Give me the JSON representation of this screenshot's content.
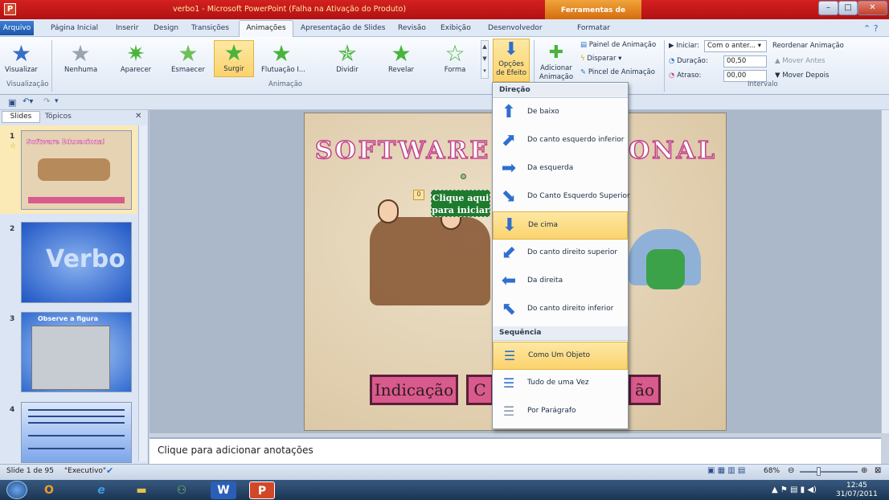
{
  "window": {
    "title": "verbo1 - Microsoft PowerPoint (Falha na Ativação do Produto)",
    "contextual_tools": "Ferramentas de Desenho"
  },
  "tabs": [
    "Arquivo",
    "Página Inicial",
    "Inserir",
    "Design",
    "Transições",
    "Animações",
    "Apresentação de Slides",
    "Revisão",
    "Exibição",
    "Desenvolvedor",
    "Formatar"
  ],
  "ribbon": {
    "preview_label": "Visualizar",
    "group_preview": "Visualização",
    "group_animation": "Animação",
    "group_timing": "Intervalo",
    "animations": [
      "Nenhuma",
      "Aparecer",
      "Esmaecer",
      "Surgir",
      "Flutuação I...",
      "Dividir",
      "Revelar",
      "Forma"
    ],
    "selected_animation": "Surgir",
    "effect_options": "Opções de Efeito",
    "effect_options_l1": "Opções",
    "effect_options_l2": "de Efeito",
    "add_animation_l1": "Adicionar",
    "add_animation_l2": "Animação",
    "animation_pane": "Painel de Animação",
    "trigger": "Disparar",
    "animation_painter": "Pincel de Animação",
    "start_label": "Iniciar:",
    "start_value": "Com o anter...",
    "duration_label": "Duração:",
    "duration_value": "00,50",
    "delay_label": "Atraso:",
    "delay_value": "00,00",
    "reorder": "Reordenar Animação",
    "move_earlier": "Mover Antes",
    "move_later": "Mover Depois"
  },
  "panel": {
    "tab_slides": "Slides",
    "tab_outline": "Tópicos"
  },
  "thumbnails": [
    {
      "num": "1",
      "title": "Software Educacional"
    },
    {
      "num": "2",
      "title": "Verbo"
    },
    {
      "num": "3",
      "title": "Observe a figura"
    },
    {
      "num": "4",
      "title": ""
    }
  ],
  "slide": {
    "title": "SOFTWARE EDUCACIONAL",
    "title_visible_left": "SOFTWARE",
    "title_visible_right": "ONAL",
    "button_text_l1": "Clique aqui",
    "button_text_l2": "para iniciar",
    "anim_tag": "0",
    "sign1": "Indicação",
    "sign2_partial": "C",
    "sign3_partial": "ão"
  },
  "dropdown": {
    "direction_header": "Direção",
    "directions": [
      "De baixo",
      "Do canto esquerdo inferior",
      "Da esquerda",
      "Do Canto Esquerdo Superior",
      "De cima",
      "Do canto direito superior",
      "Da direita",
      "Do canto direito inferior"
    ],
    "selected_direction": "De cima",
    "sequence_header": "Sequência",
    "sequences": [
      "Como Um Objeto",
      "Tudo de uma Vez",
      "Por Parágrafo"
    ],
    "selected_sequence": "Como Um Objeto"
  },
  "notes": {
    "placeholder": "Clique para adicionar anotações"
  },
  "status": {
    "slide_info": "Slide 1 de 95",
    "theme": "\"Executivo\"",
    "zoom": "68%"
  },
  "taskbar": {
    "time": "12:45",
    "date": "31/07/2011"
  }
}
